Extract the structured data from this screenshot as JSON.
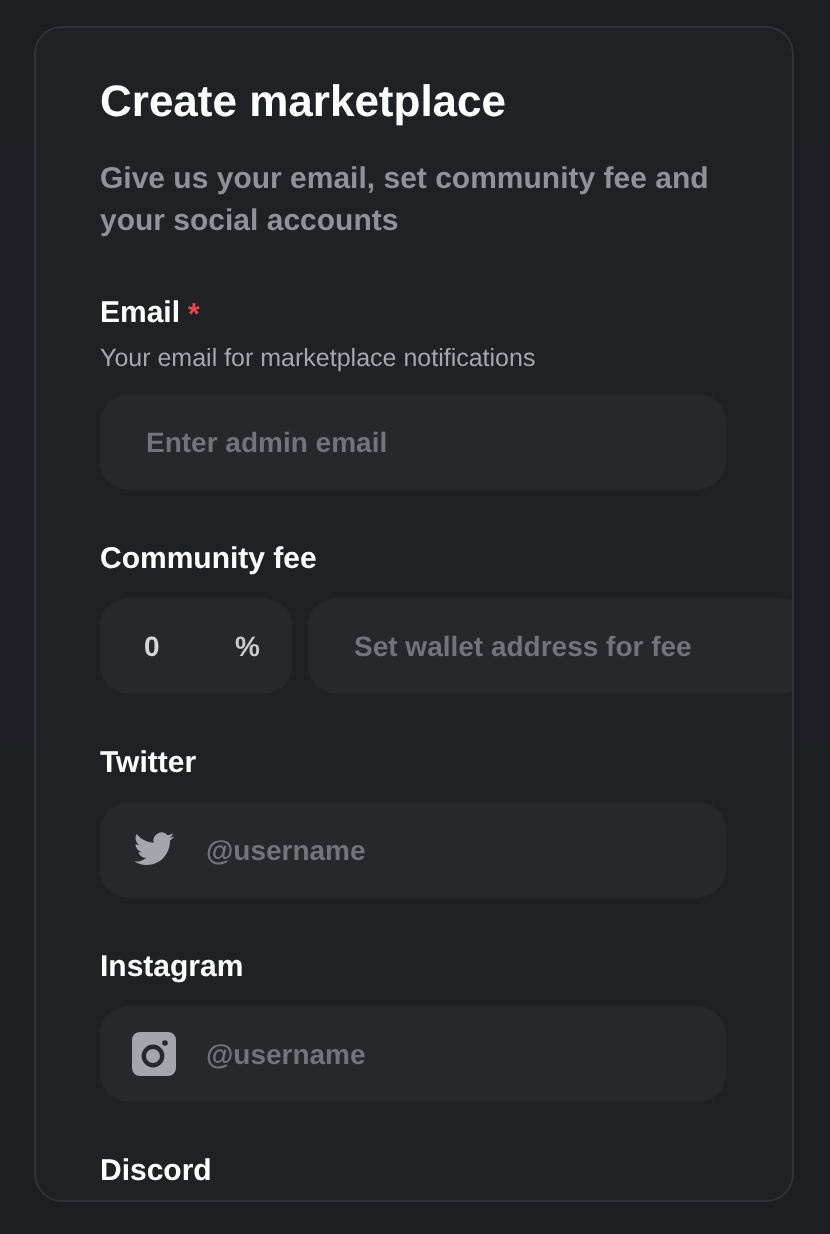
{
  "title": "Create marketplace",
  "subtitle": "Give us your email, set community fee and your social accounts",
  "sections": [
    {
      "kind": "email",
      "label": "Email",
      "required_mark": "*",
      "hint": "Your email for marketplace notifications",
      "placeholder": "Enter admin email"
    },
    {
      "kind": "fee",
      "label": "Community fee",
      "value": "0",
      "unit": "%",
      "placeholder": "Set wallet address for fee"
    },
    {
      "kind": "social",
      "label": "Twitter",
      "placeholder": "@username"
    },
    {
      "kind": "social",
      "label": "Instagram",
      "placeholder": "@username"
    },
    {
      "kind": "label",
      "label": "Discord"
    }
  ]
}
